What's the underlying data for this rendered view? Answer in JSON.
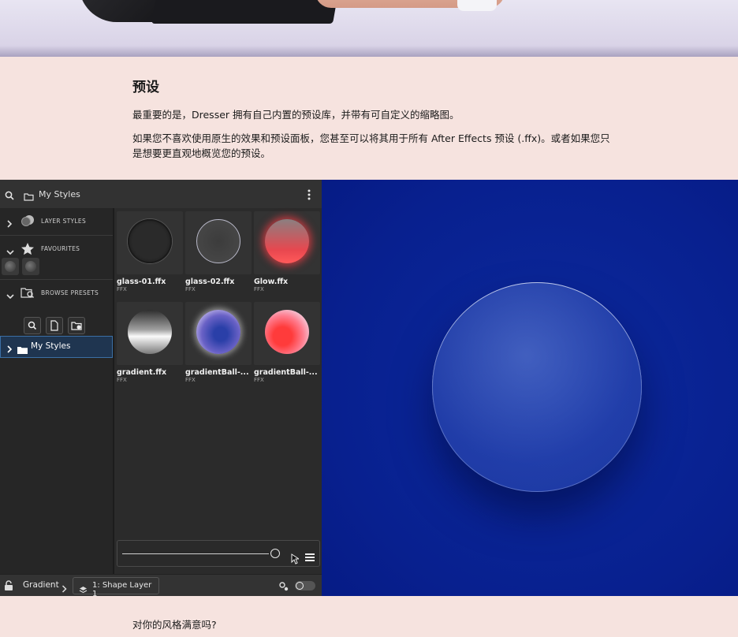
{
  "article": {
    "heading": "预设",
    "para1": "最重要的是，Dresser 拥有自己内置的预设库，并带有可自定义的缩略图。",
    "para2": "如果您不喜欢使用原生的效果和预设面板，您甚至可以将其用于所有 After Effects 预设 (.ffx)。或者如果您只是想要更直观地概览您的预设。",
    "question": "对你的风格满意吗?"
  },
  "panel": {
    "top_title": "My Styles",
    "sections": {
      "layer_styles": "LAYER STYLES",
      "favourites": "FAVOURITES",
      "browse_presets": "BROWSE PRESETS"
    },
    "tree_item": "My Styles",
    "presets": [
      {
        "name": "glass-01.ffx",
        "type": "FFX",
        "style": "dark-glass"
      },
      {
        "name": "glass-02.ffx",
        "type": "FFX",
        "style": "ring-glass"
      },
      {
        "name": "Glow.ffx",
        "type": "FFX",
        "style": "red-glow"
      },
      {
        "name": "gradient.ffx",
        "type": "FFX",
        "style": "grey-gradient"
      },
      {
        "name": "gradientBall-...",
        "type": "FFX",
        "style": "blue-ball"
      },
      {
        "name": "gradientBall-...",
        "type": "FFX",
        "style": "red-ball"
      }
    ],
    "bottom": {
      "breadcrumb": "Gradient",
      "layer": "1: Shape Layer 1"
    }
  },
  "colors": {
    "page_bg": "#f6e3df",
    "preview_bg": "#0b2296",
    "panel_bg": "#2b2b2b",
    "selection": "#3b6fa5"
  }
}
